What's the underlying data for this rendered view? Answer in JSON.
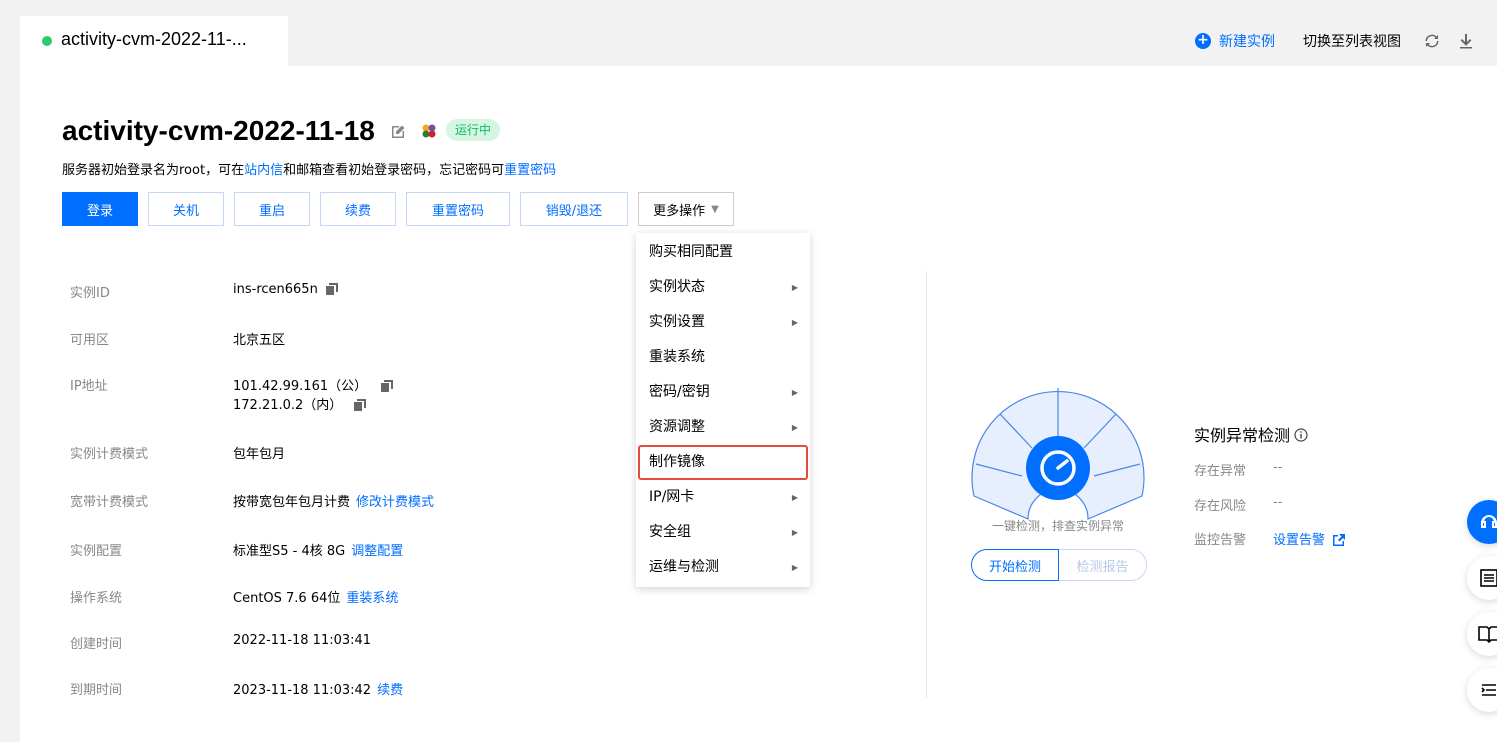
{
  "tab": {
    "title": "activity-cvm-2022-11-...",
    "status_color": "#29cc6a"
  },
  "top_actions": {
    "new_instance": "新建实例",
    "switch_view": "切换至列表视图"
  },
  "instance": {
    "title": "activity-cvm-2022-11-18",
    "status": "运行中",
    "hint_prefix": "服务器初始登录名为root，可在",
    "hint_link1": "站内信",
    "hint_middle": "和邮箱查看初始登录密码，忘记密码可",
    "hint_link2": "重置密码"
  },
  "buttons": {
    "login": "登录",
    "shutdown": "关机",
    "restart": "重启",
    "renew": "续费",
    "reset_password": "重置密码",
    "destroy": "销毁/退还",
    "more": "更多操作"
  },
  "details": [
    {
      "key": "实例ID",
      "value": "ins-rcen665n"
    },
    {
      "key": "可用区",
      "value": "北京五区"
    },
    {
      "key": "IP地址",
      "value": "101.42.99.161（公）",
      "value2": "172.21.0.2（内）"
    },
    {
      "key": "实例计费模式",
      "value": "包年包月"
    },
    {
      "key": "宽带计费模式",
      "value": "按带宽包年包月计费",
      "link": "修改计费模式"
    },
    {
      "key": "实例配置",
      "value": "标准型S5 - 4核 8G",
      "link": "调整配置"
    },
    {
      "key": "操作系统",
      "value": "CentOS 7.6 64位",
      "link": "重装系统"
    },
    {
      "key": "创建时间",
      "value": "2022-11-18 11:03:41"
    },
    {
      "key": "到期时间",
      "value": "2023-11-18 11:03:42",
      "link": "续费"
    }
  ],
  "menu": [
    {
      "label": "购买相同配置",
      "submenu": false
    },
    {
      "label": "实例状态",
      "submenu": true
    },
    {
      "label": "实例设置",
      "submenu": true
    },
    {
      "label": "重装系统",
      "submenu": false
    },
    {
      "label": "密码/密钥",
      "submenu": true
    },
    {
      "label": "资源调整",
      "submenu": true
    },
    {
      "label": "制作镜像",
      "submenu": false,
      "highlighted": true
    },
    {
      "label": "IP/网卡",
      "submenu": true
    },
    {
      "label": "安全组",
      "submenu": true
    },
    {
      "label": "运维与检测",
      "submenu": true
    }
  ],
  "detection": {
    "caption": "一键检测，排查实例异常",
    "start": "开始检测",
    "report": "检测报告"
  },
  "anomaly": {
    "title": "实例异常检测",
    "exists_anomaly_label": "存在异常",
    "exists_anomaly_value": "--",
    "exists_risk_label": "存在风险",
    "exists_risk_value": "--",
    "monitor_label": "监控告警",
    "monitor_link": "设置告警"
  },
  "colors": {
    "accent": "#006eff",
    "running_bg": "#d6f5e2",
    "running_fg": "#0abf5b",
    "highlight_border": "#e34d3f"
  }
}
